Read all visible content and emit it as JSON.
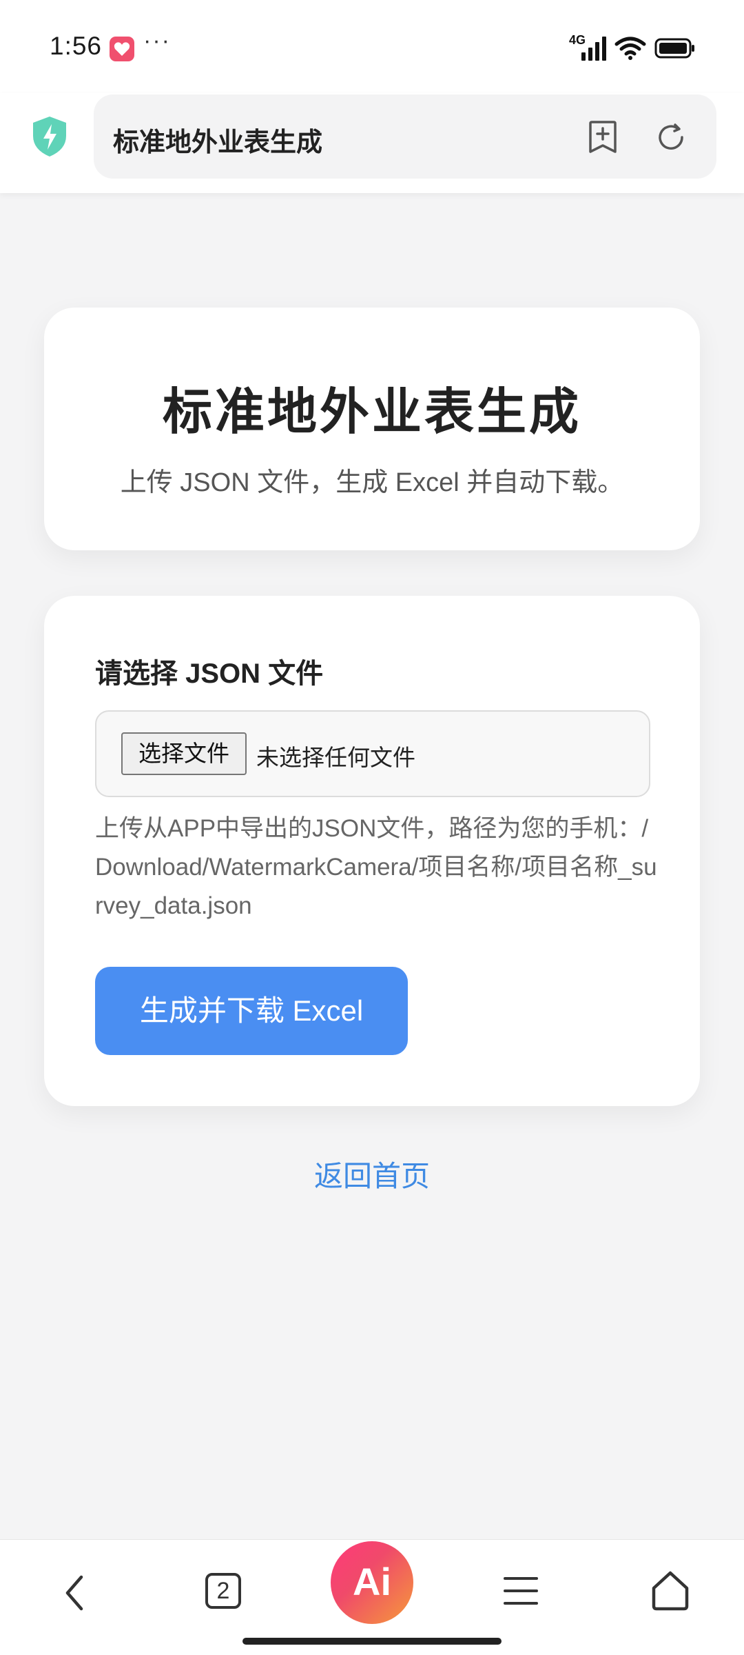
{
  "status_bar": {
    "time": "1:56",
    "more": "···",
    "signal_label": "4G"
  },
  "browser": {
    "address": "标准地外业表生成"
  },
  "hero": {
    "title": "标准地外业表生成",
    "subtitle": "上传 JSON 文件，生成 Excel 并自动下载。"
  },
  "form": {
    "label": "请选择 JSON 文件",
    "choose_button": "选择文件",
    "no_file": "未选择任何文件",
    "hint": "上传从APP中导出的JSON文件，路径为您的手机：/Download/WatermarkCamera/项目名称/项目名称_survey_data.json",
    "generate_button": "生成并下载 Excel"
  },
  "links": {
    "home": "返回首页"
  },
  "bottom_nav": {
    "tab_count": "2",
    "ai_label": "Ai"
  },
  "colors": {
    "accent": "#4a8ef2",
    "link": "#3f8ae3",
    "shield": "#5fd3b8"
  }
}
